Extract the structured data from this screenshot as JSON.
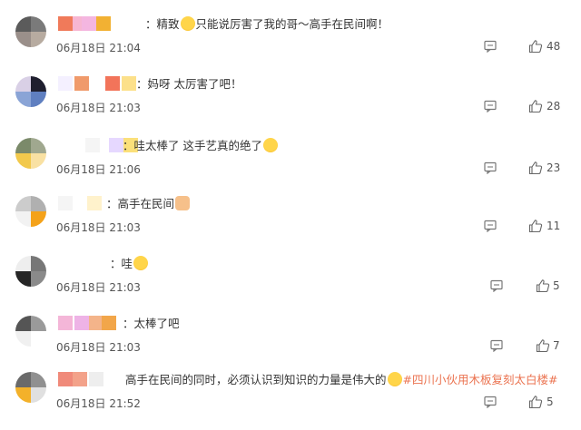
{
  "comments": [
    {
      "segments": [
        {
          "text": "：精致"
        },
        {
          "emoji": "grinning-emoji"
        },
        {
          "text": "只能说厉害了我的哥～高手在民间啊！"
        }
      ],
      "time": "06月18日 21:04",
      "likes": "48"
    },
    {
      "segments": [
        {
          "text": "：妈呀 太厉害了吧！"
        }
      ],
      "time": "06月18日 21:03",
      "likes": "28"
    },
    {
      "segments": [
        {
          "text": "：哇太棒了 这手艺真的绝了"
        },
        {
          "emoji": "surprised-emoji"
        }
      ],
      "time": "06月18日 21:06",
      "likes": "23"
    },
    {
      "segments": [
        {
          "text": "：高手在民间"
        },
        {
          "emoji": "thumbs-up-emoji"
        }
      ],
      "time": "06月18日 21:03",
      "likes": "11"
    },
    {
      "segments": [
        {
          "text": "：哇"
        },
        {
          "emoji": "grinning-emoji"
        }
      ],
      "time": "06月18日 21:03",
      "likes": "5"
    },
    {
      "segments": [
        {
          "text": "：太棒了吧"
        }
      ],
      "time": "06月18日 21:03",
      "likes": "7"
    },
    {
      "segments": [
        {
          "text": "高手在民间的同时，必须认识到知识的力量是伟大的"
        },
        {
          "emoji": "grinning-emoji"
        },
        {
          "hashtag": "#四川小伙用木板复刻太白楼#"
        }
      ],
      "time": "06月18日 21:52",
      "likes": "5"
    }
  ],
  "colors": {
    "hashtag": "#eb7350",
    "time_text": "#555555",
    "body_text": "#333333"
  }
}
